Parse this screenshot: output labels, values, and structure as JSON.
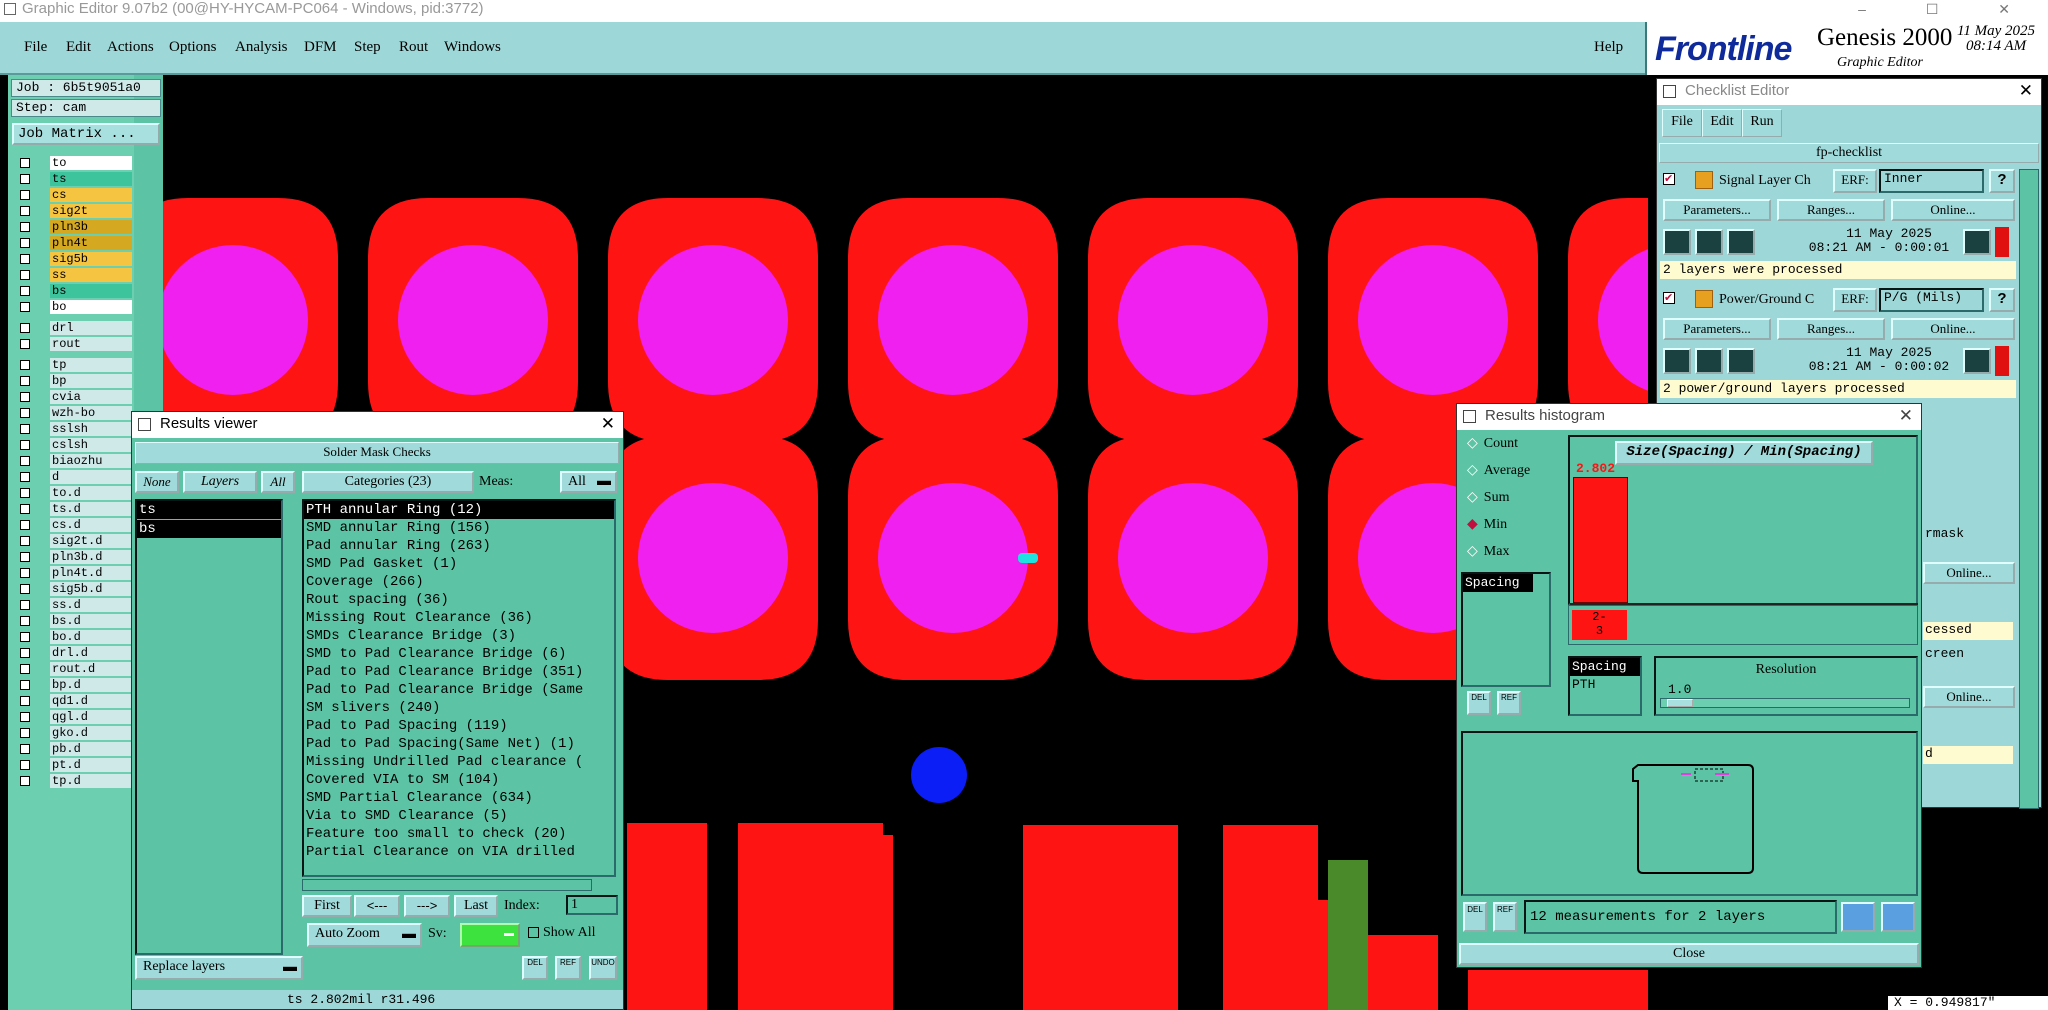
{
  "window_title": "Graphic Editor 9.07b2 (00@HY-HYCAM-PC064 - Windows, pid:3772)",
  "window_controls": "– ☐ ✕",
  "menu": [
    "File",
    "Edit",
    "Actions",
    "Options",
    "Analysis",
    "DFM",
    "Step",
    "Rout",
    "Windows"
  ],
  "help": "Help",
  "brand": {
    "logo": "Frontline",
    "product": "Genesis 2000",
    "sub": "Graphic Editor",
    "date": "11 May 2025",
    "time": "08:14 AM"
  },
  "job": "Job : 6b5t9051a0",
  "step": "Step: cam",
  "job_matrix": "Job Matrix ...",
  "layers": [
    {
      "name": "to",
      "color": "#ffffff"
    },
    {
      "name": "ts",
      "color": "#3ec49c"
    },
    {
      "name": "cs",
      "color": "#f5c542"
    },
    {
      "name": "sig2t",
      "color": "#f5c542"
    },
    {
      "name": "pln3b",
      "color": "#d4a820"
    },
    {
      "name": "pln4t",
      "color": "#d4a820"
    },
    {
      "name": "sig5b",
      "color": "#f5c542"
    },
    {
      "name": "ss",
      "color": "#f5c542"
    },
    {
      "name": "bs",
      "color": "#3ec49c"
    },
    {
      "name": "bo",
      "color": "#ffffff"
    },
    {
      "name": "drl",
      "color": "#cfe8e8"
    },
    {
      "name": "rout",
      "color": "#cfe8e8"
    },
    {
      "name": "tp",
      "color": "#cfe8e8"
    },
    {
      "name": "bp",
      "color": "#cfe8e8"
    },
    {
      "name": "cvia",
      "color": "#cfe8e8"
    },
    {
      "name": "wzh-bo",
      "color": "#cfe8e8"
    },
    {
      "name": "sslsh",
      "color": "#cfe8e8"
    },
    {
      "name": "cslsh",
      "color": "#cfe8e8"
    },
    {
      "name": "biaozhu",
      "color": "#cfe8e8"
    },
    {
      "name": "d",
      "color": "#cfe8e8"
    },
    {
      "name": "to.d",
      "color": "#cfe8e8"
    },
    {
      "name": "ts.d",
      "color": "#cfe8e8"
    },
    {
      "name": "cs.d",
      "color": "#cfe8e8"
    },
    {
      "name": "sig2t.d",
      "color": "#cfe8e8"
    },
    {
      "name": "pln3b.d",
      "color": "#cfe8e8"
    },
    {
      "name": "pln4t.d",
      "color": "#cfe8e8"
    },
    {
      "name": "sig5b.d",
      "color": "#cfe8e8"
    },
    {
      "name": "ss.d",
      "color": "#cfe8e8"
    },
    {
      "name": "bs.d",
      "color": "#cfe8e8"
    },
    {
      "name": "bo.d",
      "color": "#cfe8e8"
    },
    {
      "name": "drl.d",
      "color": "#cfe8e8"
    },
    {
      "name": "rout.d",
      "color": "#cfe8e8"
    },
    {
      "name": "bp.d",
      "color": "#cfe8e8"
    },
    {
      "name": "qd1.d",
      "color": "#cfe8e8"
    },
    {
      "name": "qgl.d",
      "color": "#cfe8e8"
    },
    {
      "name": "gko.d",
      "color": "#cfe8e8"
    },
    {
      "name": "pb.d",
      "color": "#cfe8e8"
    },
    {
      "name": "pt.d",
      "color": "#cfe8e8"
    },
    {
      "name": "tp.d",
      "color": "#cfe8e8"
    }
  ],
  "results_viewer": {
    "title": "Results viewer",
    "header": "Solder Mask Checks",
    "none": "None",
    "layers": "Layers",
    "all": "All",
    "layer_items": [
      "ts",
      "bs"
    ],
    "categories_label": "Categories (23)",
    "meas_label": "Meas:",
    "meas_value": "All",
    "categories": [
      "PTH annular Ring (12)",
      "SMD annular Ring (156)",
      "Pad annular Ring (263)",
      "SMD Pad Gasket (1)",
      "Coverage (266)",
      "Rout spacing (36)",
      "Missing Rout Clearance (36)",
      "SMDs Clearance Bridge (3)",
      "SMD to Pad Clearance Bridge (6)",
      "Pad to Pad Clearance Bridge (351)",
      "Pad to Pad Clearance Bridge (Same",
      "SM slivers (240)",
      "Pad to Pad Spacing (119)",
      "Pad to Pad Spacing(Same Net) (1)",
      "Missing Undrilled Pad clearance (",
      "Covered VIA to SM (104)",
      "SMD Partial Clearance (634)",
      "Via to SMD Clearance (5)",
      "Feature too small to check (20)",
      "Partial Clearance on VIA drilled"
    ],
    "first": "First",
    "prev": "<---",
    "next": "--->",
    "last": "Last",
    "index_label": "Index:",
    "index_value": "1",
    "zoom": "Auto Zoom",
    "sv": "Sv:",
    "show_all": "Show All",
    "replace": "Replace layers",
    "del": "DEL",
    "ref": "REF",
    "undo": "UNDO",
    "status": "ts 2.802mil  r31.496"
  },
  "checklist": {
    "title": "Checklist Editor",
    "menu": [
      "File",
      "Edit",
      "Run"
    ],
    "name": "fp-checklist",
    "checks": [
      {
        "name": "Signal Layer Ch",
        "erf": "ERF:",
        "erf_val": "Inner",
        "params": "Parameters...",
        "ranges": "Ranges...",
        "online": "Online...",
        "date": "11 May 2025",
        "time": "08:21 AM - 0:00:01",
        "msg": "2 layers were processed"
      },
      {
        "name": "Power/Ground C",
        "erf": "ERF:",
        "erf_val": "P/G (Mils)",
        "params": "Parameters...",
        "ranges": "Ranges...",
        "online": "Online...",
        "date": "11 May 2025",
        "time": "08:21 AM - 0:00:02",
        "msg": "2 power/ground layers processed"
      }
    ],
    "partial": [
      "rmask",
      "Online...",
      "cessed",
      "creen",
      "Online...",
      "d"
    ]
  },
  "histogram": {
    "title": "Results histogram",
    "modes": [
      "Count",
      "Average",
      "Sum",
      "Min",
      "Max"
    ],
    "selected": "Min",
    "chart_title": "Size(Spacing) / Min(Spacing)",
    "bar_value": "2.802",
    "bar_label": "2-\n3",
    "list_top": [
      "Spacing"
    ],
    "list_bottom": [
      "Spacing",
      "PTH"
    ],
    "resolution_label": "Resolution",
    "resolution_value": "1.0",
    "footer": "12 measurements for 2 layers",
    "close": "Close",
    "del": "DEL",
    "ref": "REF"
  },
  "coord": "X = 0.949817\""
}
